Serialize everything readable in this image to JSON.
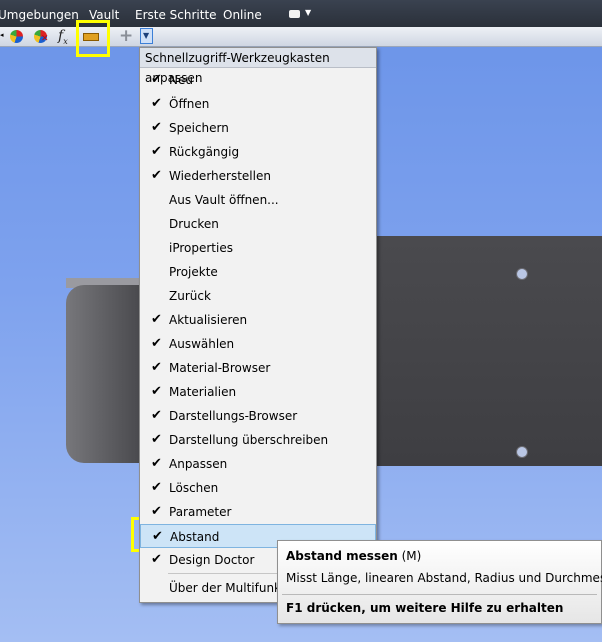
{
  "menubar": {
    "items": [
      "Umgebungen",
      "Vault",
      "Erste Schritte",
      "Online"
    ]
  },
  "toolbar": {
    "icons": [
      "appearance-icon",
      "appearance-clear-icon",
      "fx-parameters-icon",
      "measure-distance-icon",
      "add-icon",
      "customize-dropdown-icon"
    ]
  },
  "menu": {
    "header": "Schnellzugriff-Werkzeugkasten anpassen",
    "items": [
      {
        "label": "Neu",
        "checked": "✔"
      },
      {
        "label": "Öffnen",
        "checked": "✔"
      },
      {
        "label": "Speichern",
        "checked": "✔"
      },
      {
        "label": "Rückgängig",
        "checked": "✔"
      },
      {
        "label": "Wiederherstellen",
        "checked": "✔"
      },
      {
        "label": "Aus Vault öffnen...",
        "checked": ""
      },
      {
        "label": "Drucken",
        "checked": ""
      },
      {
        "label": "iProperties",
        "checked": ""
      },
      {
        "label": "Projekte",
        "checked": ""
      },
      {
        "label": "Zurück",
        "checked": ""
      },
      {
        "label": "Aktualisieren",
        "checked": "✔"
      },
      {
        "label": "Auswählen",
        "checked": "✔"
      },
      {
        "label": "Material-Browser",
        "checked": "✔"
      },
      {
        "label": "Materialien",
        "checked": "✔"
      },
      {
        "label": "Darstellungs-Browser",
        "checked": "✔"
      },
      {
        "label": "Darstellung überschreiben",
        "checked": "✔"
      },
      {
        "label": "Anpassen",
        "checked": "✔"
      },
      {
        "label": "Löschen",
        "checked": "✔"
      },
      {
        "label": "Parameter",
        "checked": "✔"
      },
      {
        "label": "Abstand",
        "checked": "✔"
      },
      {
        "label": "Design Doctor",
        "checked": "✔"
      },
      {
        "label": "Über der Multifunktionsleiste anzeigen",
        "checked": ""
      }
    ]
  },
  "tooltip": {
    "title": "Abstand messen",
    "shortcut": "(M)",
    "description": "Misst Länge, linearen Abstand, Radius und Durchmesser.",
    "help": "F1 drücken, um weitere Hilfe zu erhalten"
  },
  "colors": {
    "highlight": "#ffff00",
    "hover": "#cde4f7",
    "viewport": "#7ea2ee"
  }
}
